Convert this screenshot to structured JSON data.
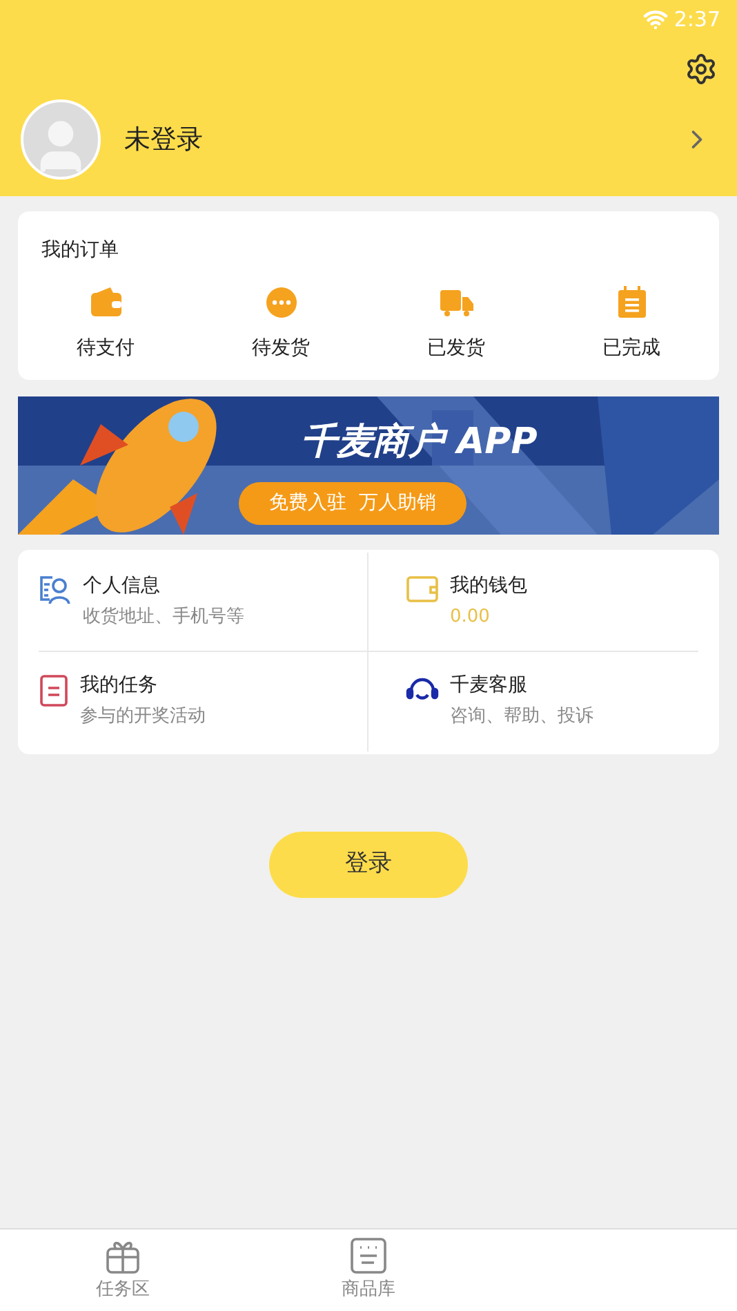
{
  "status_bar": {
    "time": "2:37"
  },
  "profile": {
    "name": "未登录"
  },
  "orders": {
    "title": "我的订单",
    "items": [
      {
        "kind": "wallet",
        "label": "待支付"
      },
      {
        "kind": "dots",
        "label": "待发货"
      },
      {
        "kind": "truck",
        "label": "已发货"
      },
      {
        "kind": "clipboard",
        "label": "已完成"
      }
    ]
  },
  "banner": {
    "title": "千麦商户 APP",
    "button": "免费入驻  万人助销"
  },
  "services": [
    {
      "kind": "profile",
      "title": "个人信息",
      "subtitle": "收货地址、手机号等"
    },
    {
      "kind": "wallet",
      "title": "我的钱包",
      "subtitle": "0.00"
    },
    {
      "kind": "tasks",
      "title": "我的任务",
      "subtitle": "参与的开奖活动"
    },
    {
      "kind": "support",
      "title": "千麦客服",
      "subtitle": "咨询、帮助、投诉"
    }
  ],
  "login_button": "登录",
  "tabs": [
    {
      "kind": "gift",
      "label": "任务区",
      "selected": false
    },
    {
      "kind": "list",
      "label": "商品库",
      "selected": false
    }
  ]
}
